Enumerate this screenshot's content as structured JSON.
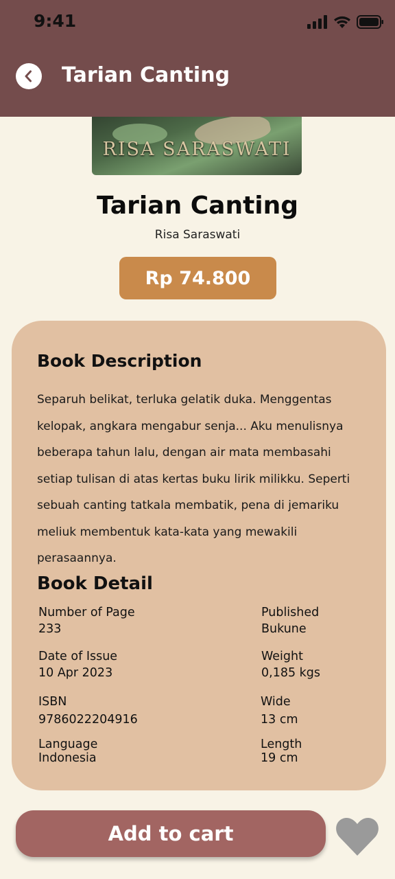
{
  "status_bar": {
    "time": "9:41"
  },
  "header": {
    "title": "Tarian Canting"
  },
  "cover": {
    "author_text": "RISA SARASWATI"
  },
  "book": {
    "title": "Tarian Canting",
    "author": "Risa Saraswati",
    "price": "Rp 74.800"
  },
  "description": {
    "heading": "Book Description",
    "text": "Separuh belikat, terluka gelatik duka. Menggentas kelopak, angkara mengabur senja... Aku menulisnya beberapa tahun lalu, dengan air mata membasahi setiap tulisan di atas kertas buku lirik milikku. Seperti sebuah canting tatkala membatik, pena di jemariku meliuk membentuk kata-kata yang mewakili perasaannya."
  },
  "details": {
    "heading": "Book Detail",
    "items": [
      {
        "label": "Number of Page",
        "value": "233"
      },
      {
        "label": "Published",
        "value": "Bukune"
      },
      {
        "label": "Date of Issue",
        "value": "10 Apr 2023"
      },
      {
        "label": "Weight",
        "value": "0,185 kgs"
      },
      {
        "label": "ISBN",
        "value": "9786022204916"
      },
      {
        "label": "Wide",
        "value": "13 cm"
      },
      {
        "label": "Language",
        "value": "Indonesia"
      },
      {
        "label": "Length",
        "value": "19 cm"
      }
    ]
  },
  "actions": {
    "add_to_cart": "Add to cart"
  },
  "colors": {
    "header": "#744c4c",
    "background": "#f8f3e6",
    "price": "#c98a4b",
    "card": "#e1c0a2",
    "cart_button": "#a26562",
    "heart": "#9a9a9a"
  }
}
